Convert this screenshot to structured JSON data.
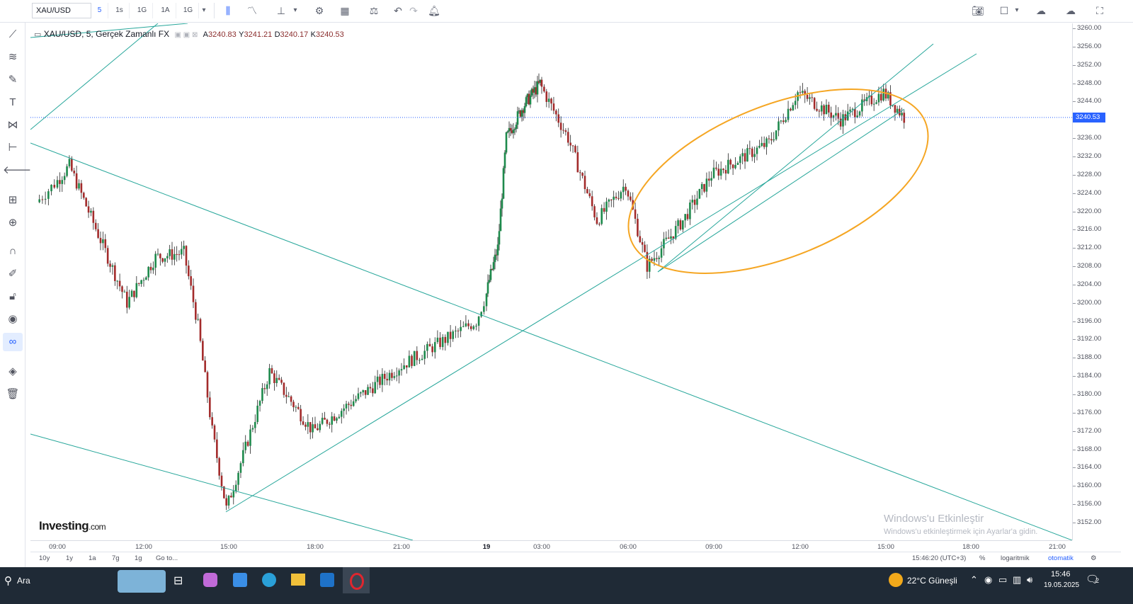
{
  "toolbar": {
    "symbol": "XAU/USD",
    "intervals": [
      "5",
      "1s",
      "1G",
      "1A",
      "1G"
    ],
    "active_interval": "5"
  },
  "legend": {
    "title": "XAU/USD, 5, Gerçek Zamanlı FX",
    "ohlc": [
      {
        "k": "A",
        "v": "3240.83"
      },
      {
        "k": "Y",
        "v": "3241.21"
      },
      {
        "k": "D",
        "v": "3240.17"
      },
      {
        "k": "K",
        "v": "3240.53"
      }
    ]
  },
  "price_axis": {
    "labels": [
      "3260.00",
      "3256.00",
      "3252.00",
      "3248.00",
      "3244.00",
      "3240.00",
      "3236.00",
      "3232.00",
      "3228.00",
      "3224.00",
      "3220.00",
      "3216.00",
      "3212.00",
      "3208.00",
      "3204.00",
      "3200.00",
      "3196.00",
      "3192.00",
      "3188.00",
      "3184.00",
      "3180.00",
      "3176.00",
      "3172.00",
      "3168.00",
      "3164.00",
      "3160.00",
      "3156.00",
      "3152.00"
    ],
    "last_price": "3240.53"
  },
  "time_axis": {
    "labels": [
      "09:00",
      "12:00",
      "15:00",
      "18:00",
      "21:00",
      "19",
      "03:00",
      "06:00",
      "09:00",
      "12:00",
      "15:00",
      "18:00",
      "21:00"
    ],
    "bold_label": "19"
  },
  "bottom_bar": {
    "ranges": [
      "10y",
      "1y",
      "1a",
      "7g",
      "1g",
      "Go to..."
    ],
    "clock": "15:46:20 (UTC+3)",
    "percent": "%",
    "log": "logaritmik",
    "auto": "otomatik"
  },
  "watermark": {
    "line1": "Windows'u Etkinleştir",
    "line2": "Windows'u etkinleştirmek için Ayarlar'a gidin."
  },
  "logo": {
    "main": "Investing",
    "suffix": ".com"
  },
  "taskbar": {
    "search": "Ara",
    "weather": "22°C  Güneşli",
    "time": "15:46",
    "date": "19.05.2025",
    "notif_count": "2"
  },
  "chart_data": {
    "type": "candlestick",
    "symbol": "XAU/USD",
    "interval": "5",
    "ylim": [
      3150,
      3262
    ],
    "last_price": 3240.53,
    "key_points": [
      {
        "time": "08:30",
        "price": 3222
      },
      {
        "time": "09:30",
        "price": 3230
      },
      {
        "time": "11:30",
        "price": 3200
      },
      {
        "time": "12:30",
        "price": 3210
      },
      {
        "time": "13:30",
        "price": 3211
      },
      {
        "time": "14:00",
        "price": 3195
      },
      {
        "time": "14:30",
        "price": 3172
      },
      {
        "time": "15:00",
        "price": 3155
      },
      {
        "time": "16:30",
        "price": 3185
      },
      {
        "time": "18:00",
        "price": 3172
      },
      {
        "time": "21:00",
        "price": 3186
      },
      {
        "time": "23:30",
        "price": 3196
      },
      {
        "time": "00:00",
        "price": 3205
      },
      {
        "time": "00:30",
        "price": 3212
      },
      {
        "time": "01:00",
        "price": 3236
      },
      {
        "time": "02:00",
        "price": 3243
      },
      {
        "time": "03:00",
        "price": 3248
      },
      {
        "time": "04:00",
        "price": 3236
      },
      {
        "time": "05:00",
        "price": 3218
      },
      {
        "time": "06:00",
        "price": 3226
      },
      {
        "time": "06:45",
        "price": 3208
      },
      {
        "time": "08:00",
        "price": 3218
      },
      {
        "time": "09:00",
        "price": 3228
      },
      {
        "time": "11:00",
        "price": 3235
      },
      {
        "time": "12:00",
        "price": 3246
      },
      {
        "time": "13:30",
        "price": 3240
      },
      {
        "time": "15:00",
        "price": 3246
      },
      {
        "time": "15:45",
        "price": 3240.53
      }
    ],
    "colors": {
      "up": "#1e8a4c",
      "down": "#a32b2b",
      "trend": "#26a69a",
      "highlight": "#f5a623",
      "last": "#2962ff"
    }
  }
}
